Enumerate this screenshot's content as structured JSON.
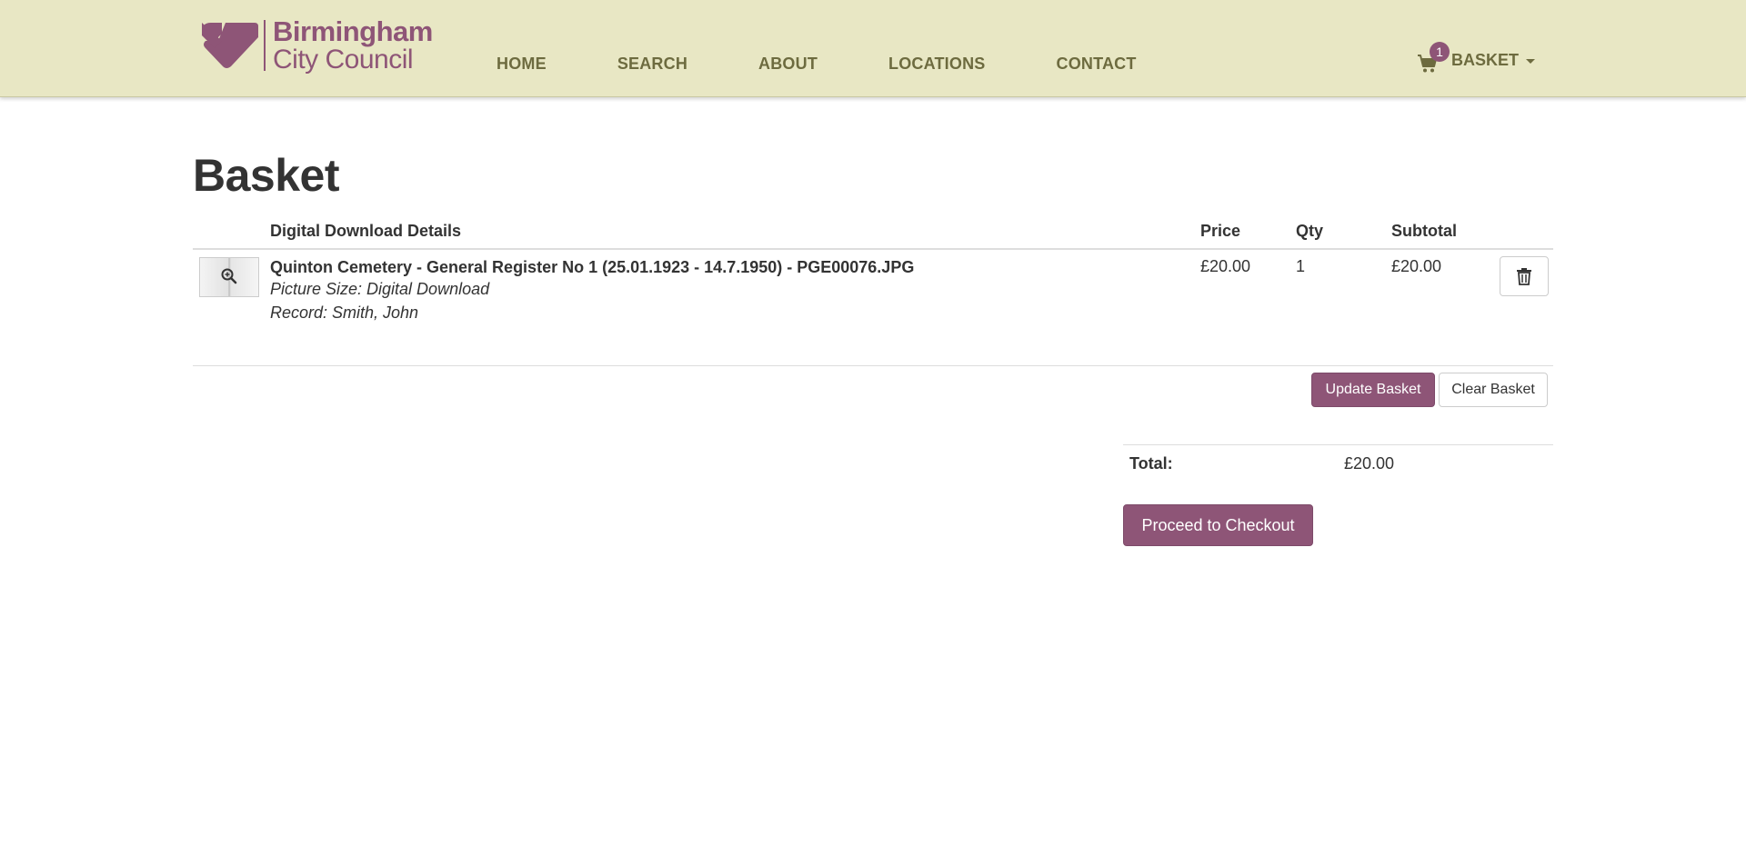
{
  "brand": {
    "line1": "Birmingham",
    "line2": "City Council",
    "color": "#8e5577",
    "header_bg": "#e8e7c4"
  },
  "nav": {
    "items": [
      {
        "label": "HOME"
      },
      {
        "label": "SEARCH"
      },
      {
        "label": "ABOUT"
      },
      {
        "label": "LOCATIONS"
      },
      {
        "label": "CONTACT"
      }
    ],
    "basket": {
      "label": "BASKET",
      "count": "1",
      "icon": "cart-icon"
    }
  },
  "page": {
    "title": "Basket"
  },
  "table": {
    "headers": {
      "details": "Digital Download Details",
      "price": "Price",
      "qty": "Qty",
      "subtotal": "Subtotal"
    },
    "rows": [
      {
        "title": "Quinton Cemetery - General Register No 1 (25.01.1923 - 14.7.1950) - PGE00076.JPG",
        "picture_size": "Picture Size: Digital Download",
        "record": "Record: Smith, John",
        "price": "£20.00",
        "qty": "1",
        "subtotal": "£20.00"
      }
    ]
  },
  "actions": {
    "update": "Update Basket",
    "clear": "Clear Basket",
    "checkout": "Proceed to Checkout"
  },
  "totals": {
    "label": "Total:",
    "value": "£20.00"
  }
}
